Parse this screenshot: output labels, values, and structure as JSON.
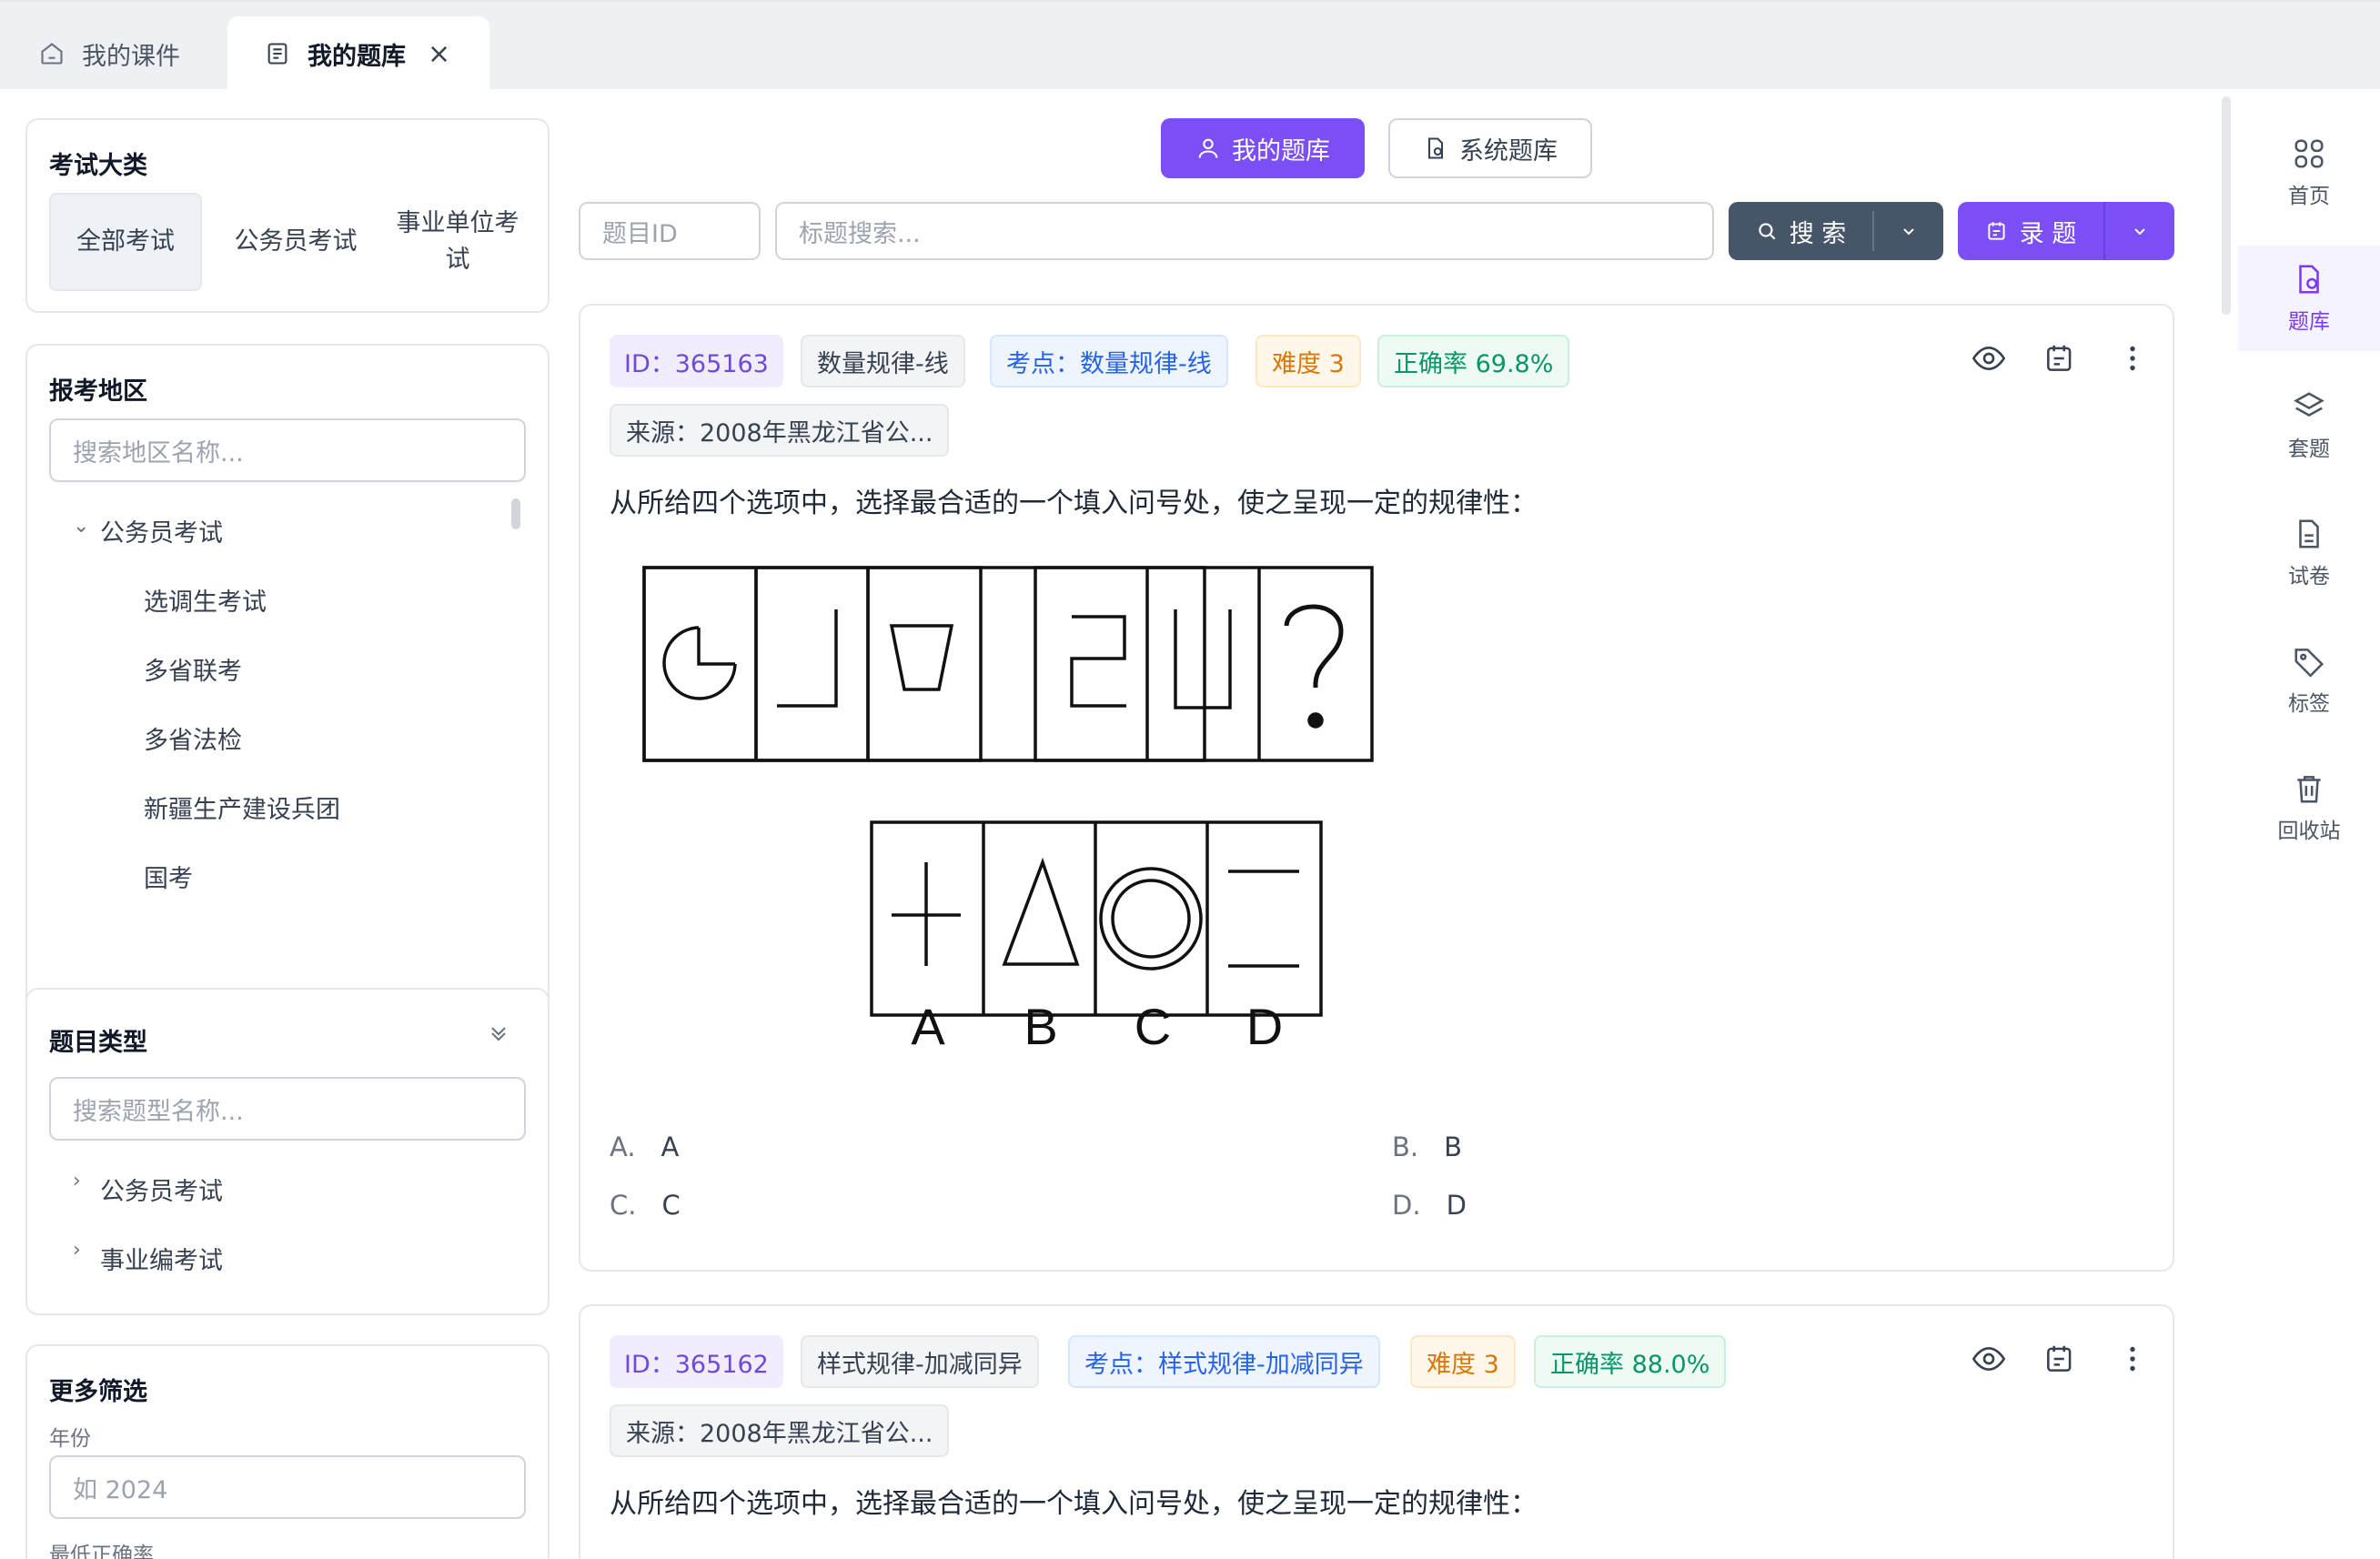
{
  "tabs": [
    {
      "label": "我的课件",
      "icon": "home-icon"
    },
    {
      "label": "我的题库",
      "icon": "question-bank-icon",
      "close": "×"
    }
  ],
  "exam_category": {
    "title": "考试大类",
    "options": [
      "全部考试",
      "公务员考试",
      "事业单位考试"
    ],
    "active_index": 0
  },
  "region": {
    "title": "报考地区",
    "search_placeholder": "搜索地区名称...",
    "root": "公务员考试",
    "children": [
      "选调生考试",
      "多省联考",
      "多省法检",
      "新疆生产建设兵团",
      "国考"
    ]
  },
  "question_type": {
    "title": "题目类型",
    "search_placeholder": "搜索题型名称...",
    "items": [
      "公务员考试",
      "事业编考试"
    ]
  },
  "more_filters": {
    "title": "更多筛选",
    "year_label": "年份",
    "year_placeholder": "如 2024",
    "min_accuracy_label": "最低正确率"
  },
  "bank_switch": {
    "mine": "我的题库",
    "system": "系统题库"
  },
  "toolbar": {
    "id_placeholder": "题目ID",
    "title_placeholder": "标题搜索...",
    "search_label": "搜 索",
    "record_label": "录 题"
  },
  "questions": [
    {
      "id": "ID：365163",
      "category": "数量规律-线",
      "point": "考点：数量规律-线",
      "difficulty": "难度 3",
      "accuracy": "正确率 69.8%",
      "source": "来源：2008年黑龙江省公...",
      "stem": "从所给四个选项中，选择最合适的一个填入问号处，使之呈现一定的规律性：",
      "figure_labels": [
        "A",
        "B",
        "C",
        "D"
      ],
      "options": [
        {
          "letter": "A.",
          "text": "A"
        },
        {
          "letter": "B.",
          "text": "B"
        },
        {
          "letter": "C.",
          "text": "C"
        },
        {
          "letter": "D.",
          "text": "D"
        }
      ]
    },
    {
      "id": "ID：365162",
      "category": "样式规律-加减同异",
      "point": "考点：样式规律-加减同异",
      "difficulty": "难度 3",
      "accuracy": "正确率 88.0%",
      "source": "来源：2008年黑龙江省公...",
      "stem": "从所给四个选项中，选择最合适的一个填入问号处，使之呈现一定的规律性："
    }
  ],
  "rail": [
    {
      "label": "首页",
      "icon": "grid-icon"
    },
    {
      "label": "题库",
      "icon": "question-bank-icon",
      "active": true
    },
    {
      "label": "套题",
      "icon": "layers-icon"
    },
    {
      "label": "试卷",
      "icon": "document-icon"
    },
    {
      "label": "标签",
      "icon": "tag-icon"
    },
    {
      "label": "回收站",
      "icon": "trash-icon"
    }
  ],
  "colors": {
    "accent": "#7c3aed",
    "accent_button": "#7b4ff5",
    "search_button": "#475569"
  }
}
